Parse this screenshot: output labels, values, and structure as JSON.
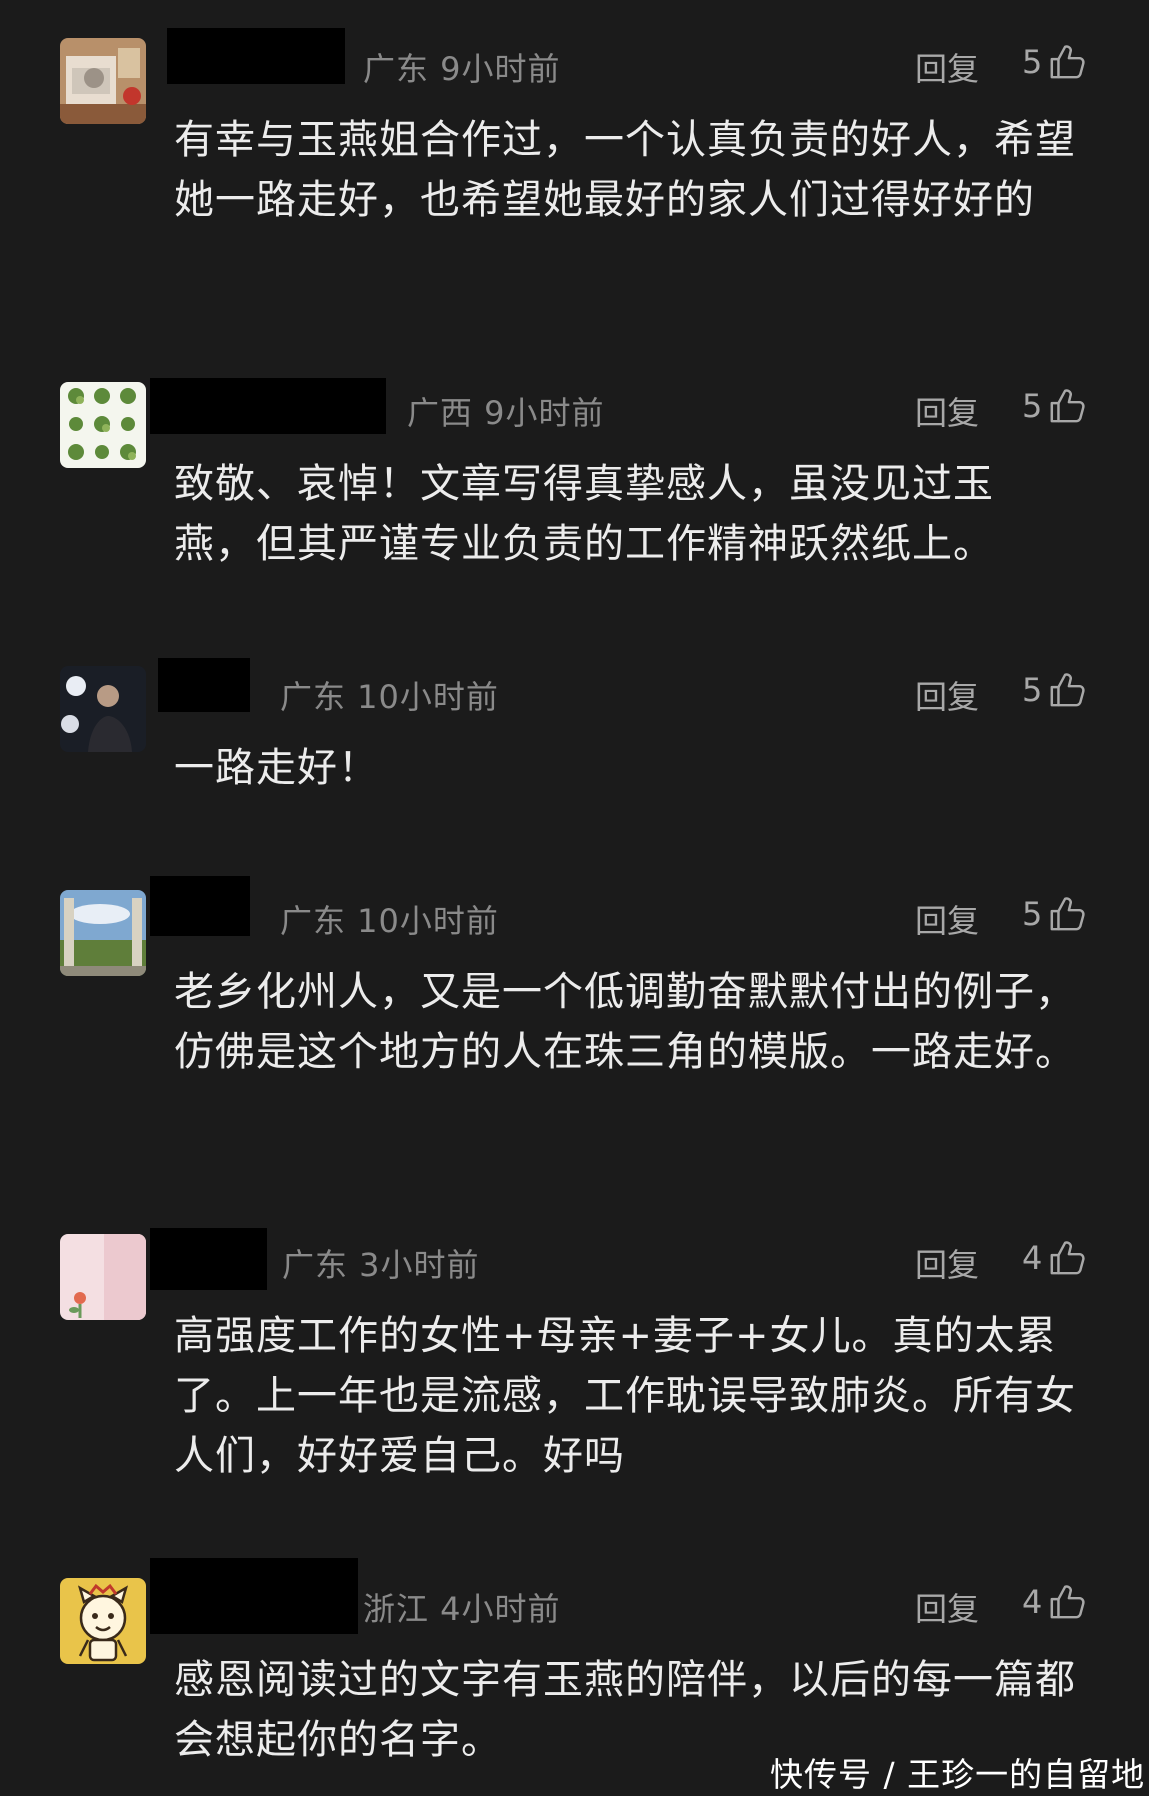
{
  "comments": [
    {
      "meta": "广东 9小时前",
      "reply": "回复",
      "likes": "5",
      "text": "有幸与玉燕姐合作过，一个认真负责的好人，希望她一路走好，也希望她最好的家人们过得好好的",
      "avatar": "photo-avatar"
    },
    {
      "meta": "广西 9小时前",
      "reply": "回复",
      "likes": "5",
      "text": "致敬、哀悼！文章写得真挚感人，虽没见过玉燕，但其严谨专业负责的工作精神跃然纸上。",
      "avatar": "plants-grid-avatar"
    },
    {
      "meta": "广东 10小时前",
      "reply": "回复",
      "likes": "5",
      "text": "一路走好！",
      "avatar": "portrait-avatar"
    },
    {
      "meta": "广东 10小时前",
      "reply": "回复",
      "likes": "5",
      "text": "老乡化州人，又是一个低调勤奋默默付出的例子，仿佛是这个地方的人在珠三角的模版。一路走好。",
      "avatar": "landscape-avatar"
    },
    {
      "meta": "广东 3小时前",
      "reply": "回复",
      "likes": "4",
      "text": "高强度工作的女性+母亲+妻子+女儿。真的太累了。上一年也是流感，工作耽误导致肺炎。所有女人们，好好爱自己。好吗",
      "avatar": "pink-flower-avatar"
    },
    {
      "meta": "浙江 4小时前",
      "reply": "回复",
      "likes": "4",
      "text": "感恩阅读过的文字有玉燕的陪伴，以后的每一篇都会想起你的名字。",
      "avatar": "cartoon-cat-avatar"
    }
  ],
  "watermark": "快传号 / 王珍一的自留地",
  "colors": {
    "background": "#1b1b1b",
    "body_text": "#ececec",
    "meta_text": "#8a8a8a",
    "action_text": "#a8a8a8"
  }
}
